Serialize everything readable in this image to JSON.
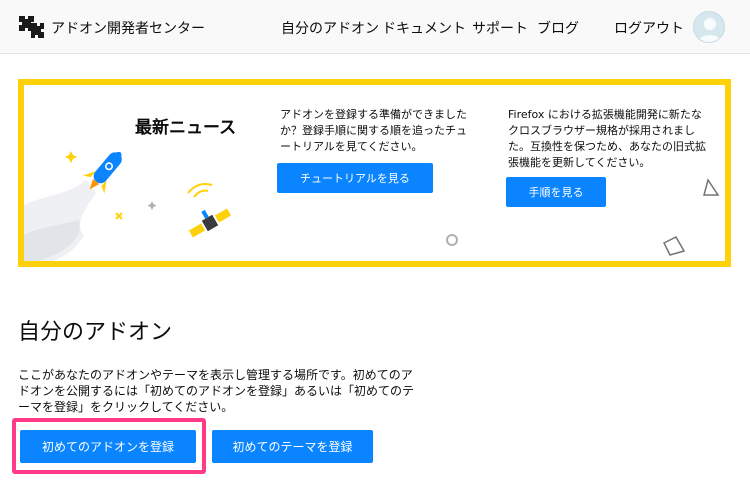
{
  "header": {
    "site_title": "アドオン開発者センター",
    "nav": {
      "my_addons": "自分のアドオン",
      "documents": "ドキュメント",
      "support": "サポート",
      "blog": "ブログ",
      "logout": "ログアウト"
    },
    "logo_icon": "puzzle-logo-icon",
    "avatar_icon": "user-avatar-icon"
  },
  "news": {
    "heading": "最新ニュース",
    "item1": {
      "text": "アドオンを登録する準備ができましたか？登録手順に関する順を追ったチュートリアルを見てください。",
      "button": "チュートリアルを見る"
    },
    "item2": {
      "text": "Firefox における拡張機能開発に新たなクロスブラウザー規格が採用されました。互換性を保つため、あなたの旧式拡張機能を更新してください。",
      "button": "手順を見る"
    },
    "border_color": "#ffd10a"
  },
  "main": {
    "title": "自分のアドオン",
    "intro": "ここがあなたのアドオンやテーマを表示し管理する場所です。初めてのアドオンを公開するには「初めてのアドオンを登録」あるいは「初めてのテーマを登録」をクリックしてください。",
    "submit_addon": "初めてのアドオンを登録",
    "submit_theme": "初めてのテーマを登録"
  },
  "colors": {
    "accent": "#0a84ff",
    "highlight": "#ff3b87"
  }
}
